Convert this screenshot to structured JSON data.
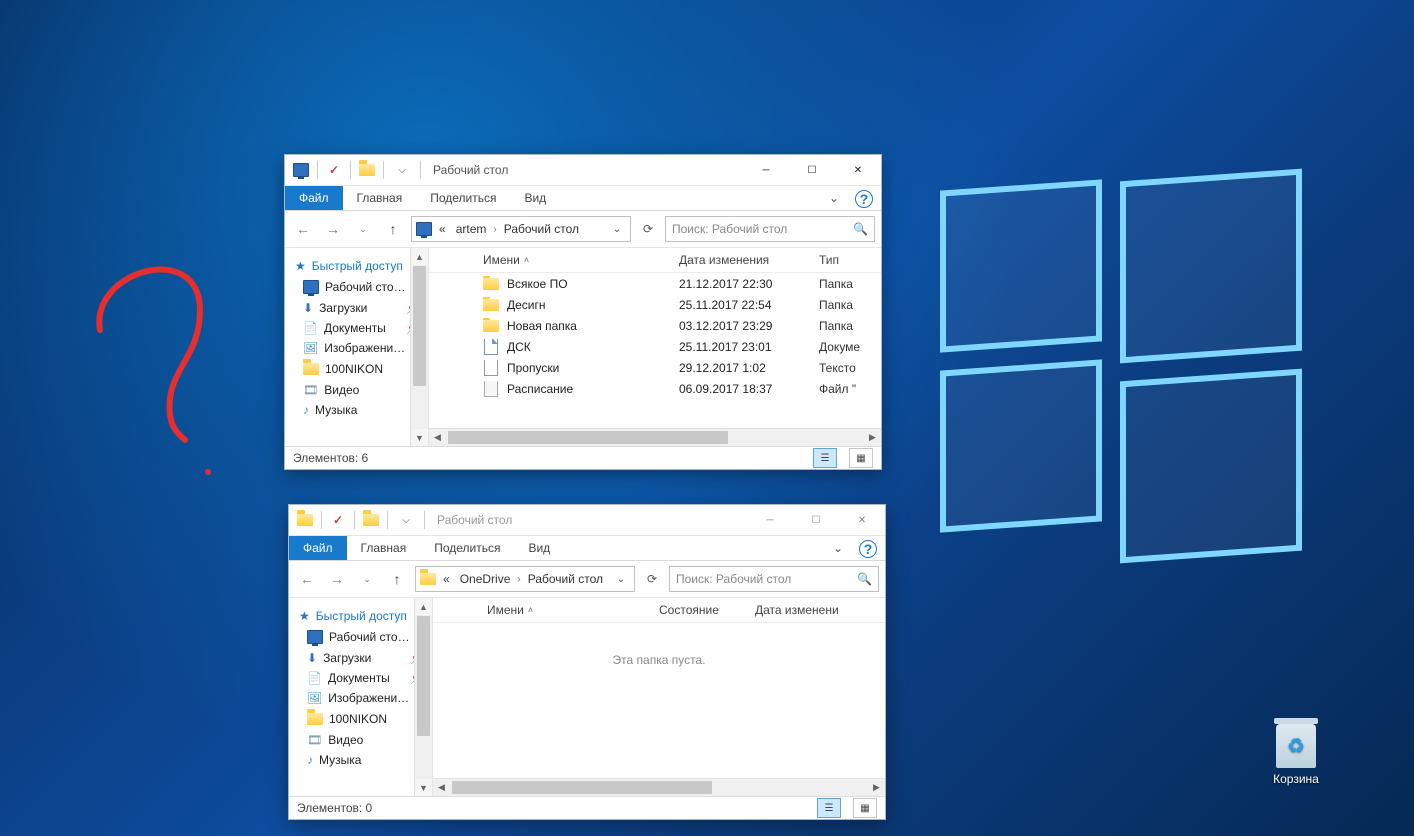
{
  "desktop": {
    "recycle_bin": "Корзина"
  },
  "win1": {
    "title": "Рабочий стол",
    "tabs": {
      "file": "Файл",
      "home": "Главная",
      "share": "Поделиться",
      "view": "Вид"
    },
    "breadcrumb": {
      "prefix": "«",
      "p1": "artem",
      "p2": "Рабочий стол"
    },
    "search_placeholder": "Поиск: Рабочий стол",
    "sidebar": {
      "quick": "Быстрый доступ",
      "items": [
        "Рабочий сто…",
        "Загрузки",
        "Документы",
        "Изображени…",
        "100NIKON",
        "Видео",
        "Музыка"
      ]
    },
    "headers": {
      "name": "Имени",
      "date": "Дата изменения",
      "type": "Тип"
    },
    "files": [
      {
        "name": "Всякое ПО",
        "date": "21.12.2017 22:30",
        "type": "Папка",
        "icon": "folder"
      },
      {
        "name": "Десигн",
        "date": "25.11.2017 22:54",
        "type": "Папка",
        "icon": "folder"
      },
      {
        "name": "Новая папка",
        "date": "03.12.2017 23:29",
        "type": "Папка",
        "icon": "folder"
      },
      {
        "name": "ДСК",
        "date": "25.11.2017 23:01",
        "type": "Докуме",
        "icon": "doc"
      },
      {
        "name": "Пропуски",
        "date": "29.12.2017 1:02",
        "type": "Тексто",
        "icon": "text"
      },
      {
        "name": "Расписание",
        "date": "06.09.2017 18:37",
        "type": "Файл \"",
        "icon": "gen"
      }
    ],
    "status": "Элементов: 6"
  },
  "win2": {
    "title": "Рабочий стол",
    "tabs": {
      "file": "Файл",
      "home": "Главная",
      "share": "Поделиться",
      "view": "Вид"
    },
    "breadcrumb": {
      "prefix": "«",
      "p1": "OneDrive",
      "p2": "Рабочий стол"
    },
    "search_placeholder": "Поиск: Рабочий стол",
    "sidebar": {
      "quick": "Быстрый доступ",
      "items": [
        "Рабочий сто…",
        "Загрузки",
        "Документы",
        "Изображени…",
        "100NIKON",
        "Видео",
        "Музыка"
      ]
    },
    "headers": {
      "name": "Имени",
      "state": "Состояние",
      "date": "Дата изменени"
    },
    "empty": "Эта папка пуста.",
    "status": "Элементов: 0"
  }
}
